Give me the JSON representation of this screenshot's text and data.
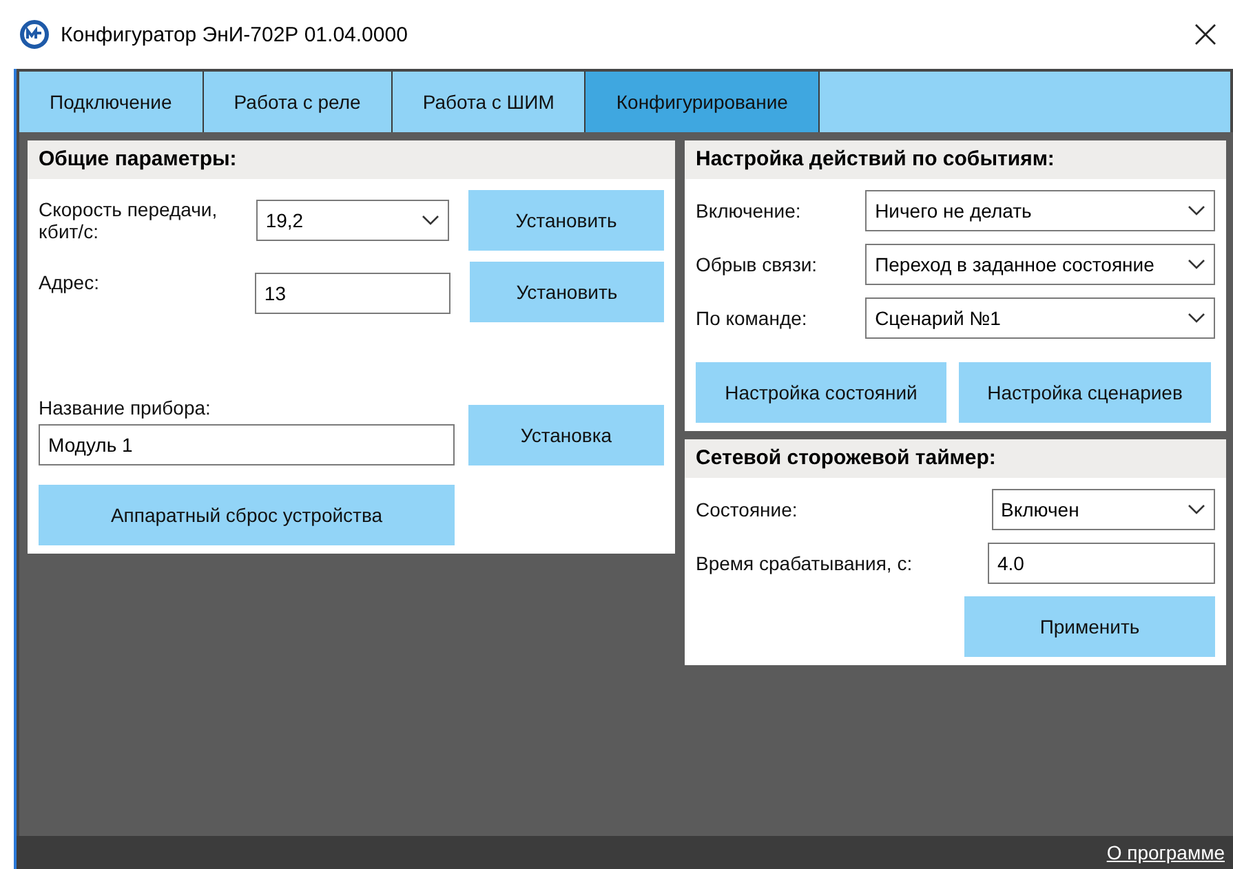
{
  "window": {
    "title": "Конфигуратор ЭнИ-702Р 01.04.0000"
  },
  "tabs": [
    {
      "label": "Подключение",
      "selected": false
    },
    {
      "label": "Работа с реле",
      "selected": false
    },
    {
      "label": "Работа с ШИМ",
      "selected": false
    },
    {
      "label": "Конфигурирование",
      "selected": true
    }
  ],
  "general": {
    "title": "Общие параметры:",
    "speed": {
      "label": "Скорость передачи, кбит/с:",
      "value": "19,2",
      "button": "Установить"
    },
    "address": {
      "label": "Адрес:",
      "value": "13",
      "button": "Установить"
    },
    "name": {
      "label": "Название прибора:",
      "value": "Модуль 1",
      "button": "Установка"
    },
    "reset_button": "Аппаратный сброс устройства"
  },
  "events": {
    "title": "Настройка действий по событиям:",
    "rows": [
      {
        "label": "Включение:",
        "value": "Ничего не делать"
      },
      {
        "label": "Обрыв связи:",
        "value": "Переход в заданное состояние"
      },
      {
        "label": "По команде:",
        "value": "Сценарий №1"
      }
    ],
    "buttons": [
      "Настройка состояний",
      "Настройка сценариев"
    ]
  },
  "watchdog": {
    "title": "Сетевой сторожевой таймер:",
    "state": {
      "label": "Состояние:",
      "value": "Включен"
    },
    "time": {
      "label": "Время срабатывания, с:",
      "value": "4.0"
    },
    "button": "Применить"
  },
  "status_bar": {
    "link": "О программе"
  }
}
